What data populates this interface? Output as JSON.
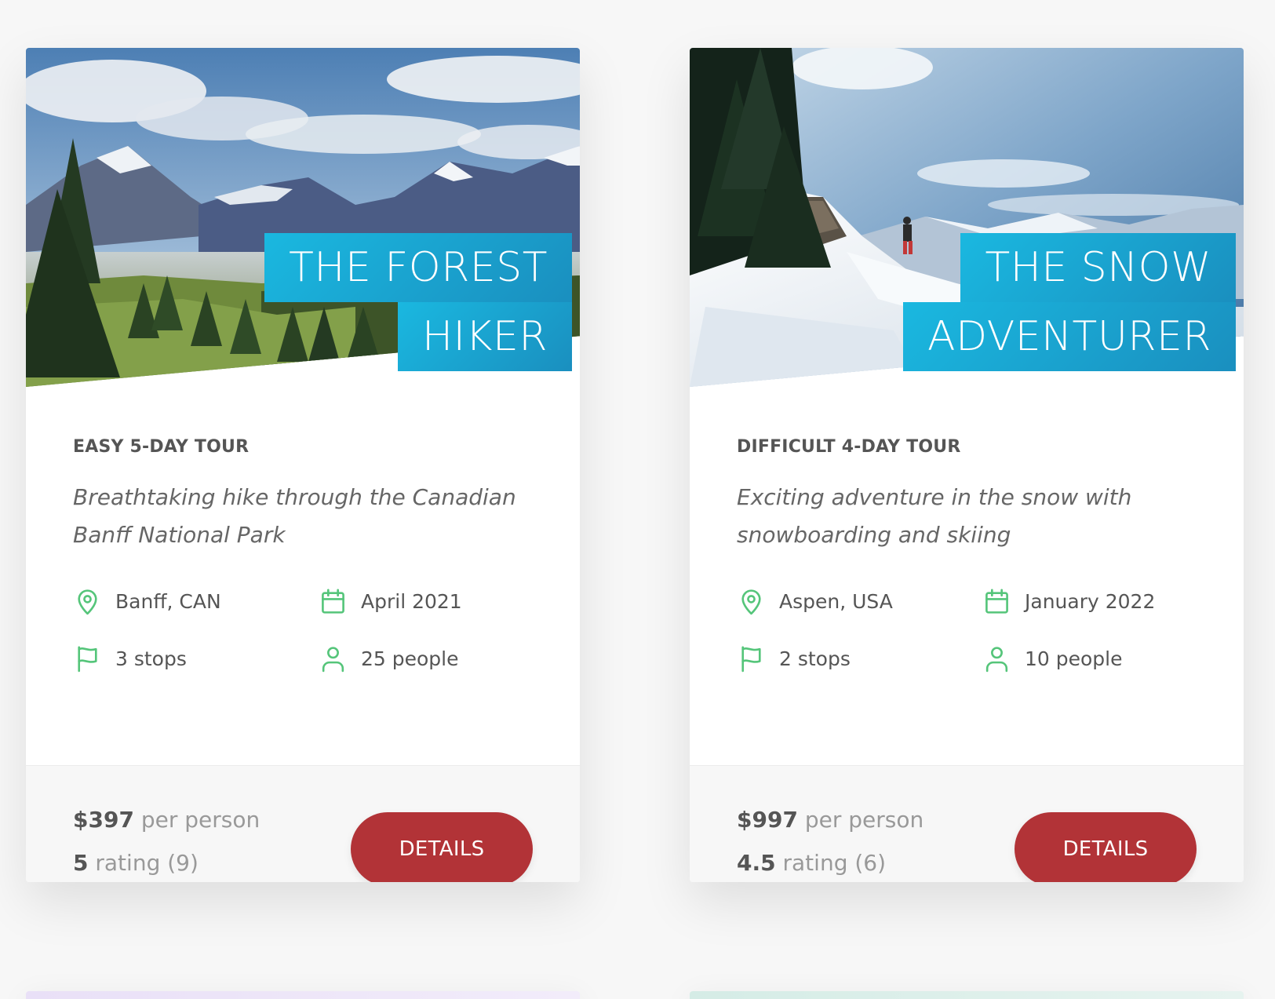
{
  "tours": [
    {
      "heading_line1": "THE FOREST",
      "heading_line2": "HIKER",
      "sub_heading": "EASY 5-DAY TOUR",
      "summary": "Breathtaking hike through the Canadian Banff National Park",
      "location": "Banff, CAN",
      "date": "April 2021",
      "stops": "3 stops",
      "group": "25 people",
      "price_value": "$397",
      "price_text": "per person",
      "rating_value": "5",
      "rating_text": "rating (9)",
      "button": "DETAILS",
      "image": "mountain-forest-landscape"
    },
    {
      "heading_line1": "THE SNOW",
      "heading_line2": "ADVENTURER",
      "sub_heading": "DIFFICULT 4-DAY TOUR",
      "summary": "Exciting adventure in the snow with snowboarding and skiing",
      "location": "Aspen, USA",
      "date": "January 2022",
      "stops": "2 stops",
      "group": "10 people",
      "price_value": "$997",
      "price_text": "per person",
      "rating_value": "4.5",
      "rating_text": "rating (6)",
      "button": "DETAILS",
      "image": "snowy-mountain-hiker"
    }
  ],
  "icons": {
    "location": "map-pin-icon",
    "date": "calendar-icon",
    "stops": "flag-icon",
    "group": "user-icon"
  },
  "colors": {
    "accent_green": "#55c57a",
    "heading_blue": "#1a9ccf",
    "button_red": "#b23337"
  }
}
